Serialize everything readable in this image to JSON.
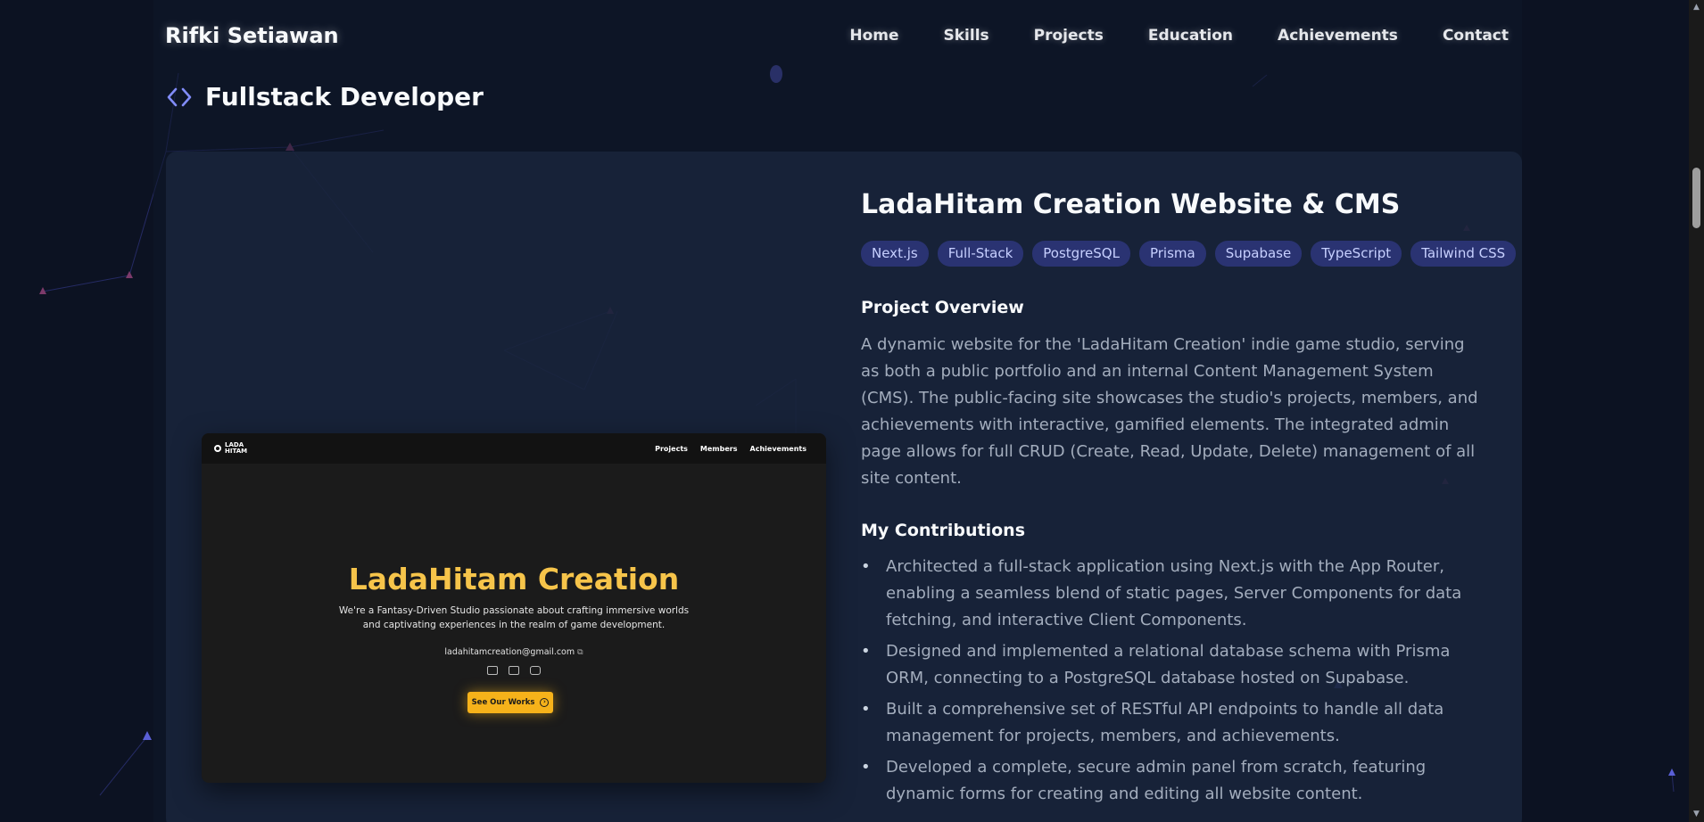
{
  "nav": {
    "brand": "Rifki Setiawan",
    "links": [
      "Home",
      "Skills",
      "Projects",
      "Education",
      "Achievements",
      "Contact"
    ]
  },
  "section": {
    "title": "Fullstack Developer",
    "icon": "code-icon"
  },
  "project": {
    "title": "LadaHitam Creation Website & CMS",
    "tags": [
      "Next.js",
      "Full-Stack",
      "PostgreSQL",
      "Prisma",
      "Supabase",
      "TypeScript",
      "Tailwind CSS"
    ],
    "overview_heading": "Project Overview",
    "overview": "A dynamic website for the 'LadaHitam Creation' indie game studio, serving as both a public portfolio and an internal Content Management System (CMS). The public-facing site showcases the studio's projects, members, and achievements with interactive, gamified elements. The integrated admin page allows for full CRUD (Create, Read, Update, Delete) management of all site content.",
    "contributions_heading": "My Contributions",
    "contributions": [
      "Architected a full-stack application using Next.js with the App Router, enabling a seamless blend of static pages, Server Components for data fetching, and interactive Client Components.",
      "Designed and implemented a relational database schema with Prisma ORM, connecting to a PostgreSQL database hosted on Supabase.",
      "Built a comprehensive set of RESTful API endpoints to handle all data management for projects, members, and achievements.",
      "Developed a complete, secure admin panel from scratch, featuring dynamic forms for creating and editing all website content."
    ]
  },
  "preview": {
    "logo_text": "LADA HITAM",
    "nav_links": [
      "Projects",
      "Members",
      "Achievements"
    ],
    "title": "LadaHitam Creation",
    "subtitle": "We're a Fantasy-Driven Studio passionate about crafting immersive worlds and captivating experiences in the realm of game development.",
    "email": "ladahitamcreation@gmail.com",
    "socials": [
      "discord-icon",
      "linkedin-icon",
      "instagram-icon"
    ],
    "cta": "See Our Works"
  },
  "colors": {
    "background": "#0c1222",
    "card": "#1a253d",
    "tag_bg": "#2a3372",
    "tag_text": "#c7d0ff",
    "accent_gold": "#f6c44a"
  }
}
